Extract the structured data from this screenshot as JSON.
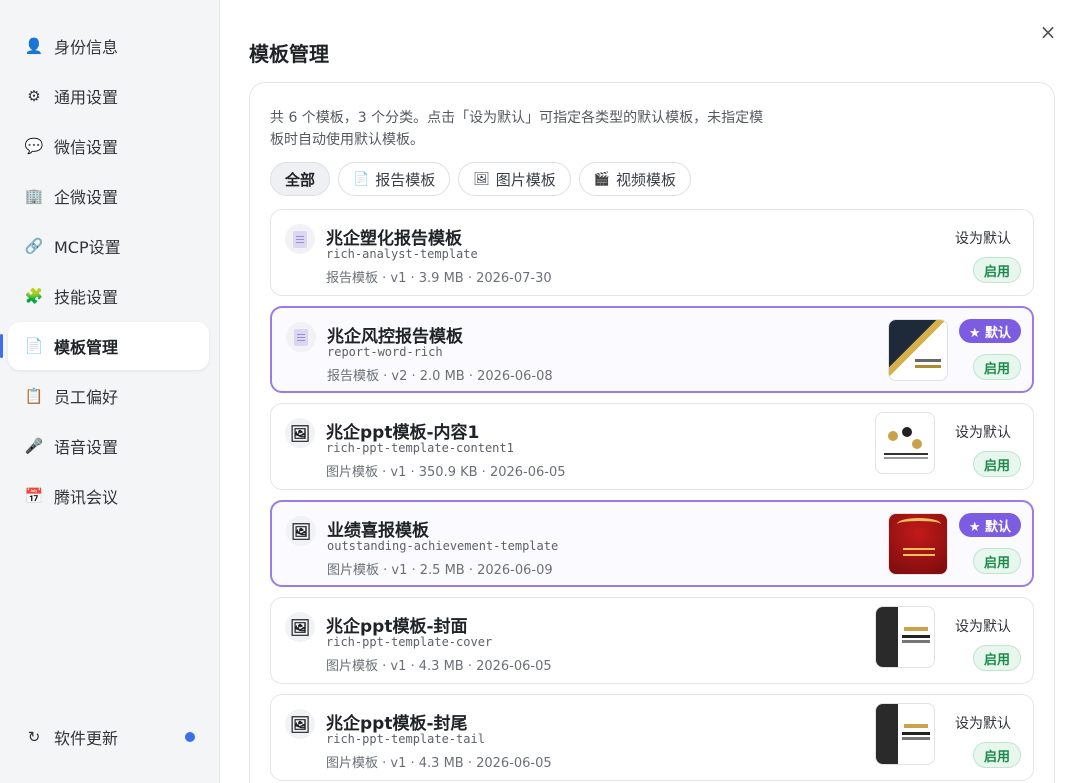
{
  "sidebar": {
    "items": [
      {
        "label": "身份信息",
        "icon": "👤",
        "active": false
      },
      {
        "label": "通用设置",
        "icon": "⚙",
        "active": false
      },
      {
        "label": "微信设置",
        "icon": "💬",
        "active": false
      },
      {
        "label": "企微设置",
        "icon": "🏢",
        "active": false
      },
      {
        "label": "MCP设置",
        "icon": "🔗",
        "active": false
      },
      {
        "label": "技能设置",
        "icon": "🧩",
        "active": false
      },
      {
        "label": "模板管理",
        "icon": "📄",
        "active": true
      },
      {
        "label": "员工偏好",
        "icon": "📋",
        "active": false
      },
      {
        "label": "语音设置",
        "icon": "🎤",
        "active": false
      },
      {
        "label": "腾讯会议",
        "icon": "📅",
        "active": false
      }
    ],
    "update": {
      "label": "软件更新",
      "icon": "↻"
    }
  },
  "main": {
    "title": "模板管理",
    "close_icon": "×",
    "description": "共 6 个模板，3 个分类。点击「设为默认」可指定各类型的默认模板，未指定模板时自动使用默认模板。",
    "filters": [
      {
        "label": "全部",
        "icon": "",
        "active": true
      },
      {
        "label": "报告模板",
        "icon": "📄",
        "active": false
      },
      {
        "label": "图片模板",
        "icon": "🖼",
        "active": false
      },
      {
        "label": "视频模板",
        "icon": "🎬",
        "active": false
      }
    ],
    "set_default_label": "设为默认",
    "default_badge_label": "★ 默认",
    "enabled_label": "启用",
    "templates": [
      {
        "title": "兆企塑化报告模板",
        "slug": "rich-analyst-template",
        "meta": "报告模板 · v1 · 3.9 MB · 2026-07-30",
        "kind": "report",
        "is_default": false,
        "thumb": "none"
      },
      {
        "title": "兆企风控报告模板",
        "slug": "report-word-rich",
        "meta": "报告模板 · v2 · 2.0 MB · 2026-06-08",
        "kind": "report",
        "is_default": true,
        "thumb": "report"
      },
      {
        "title": "兆企ppt模板-内容1",
        "slug": "rich-ppt-template-content1",
        "meta": "图片模板 · v1 · 350.9 KB · 2026-06-05",
        "kind": "image",
        "is_default": false,
        "thumb": "content"
      },
      {
        "title": "业绩喜报模板",
        "slug": "outstanding-achievement-template",
        "meta": "图片模板 · v1 · 2.5 MB · 2026-06-09",
        "kind": "image",
        "is_default": true,
        "thumb": "red"
      },
      {
        "title": "兆企ppt模板-封面",
        "slug": "rich-ppt-template-cover",
        "meta": "图片模板 · v1 · 4.3 MB · 2026-06-05",
        "kind": "image",
        "is_default": false,
        "thumb": "dark"
      },
      {
        "title": "兆企ppt模板-封尾",
        "slug": "rich-ppt-template-tail",
        "meta": "图片模板 · v1 · 4.3 MB · 2026-06-05",
        "kind": "image",
        "is_default": false,
        "thumb": "dark"
      }
    ]
  }
}
